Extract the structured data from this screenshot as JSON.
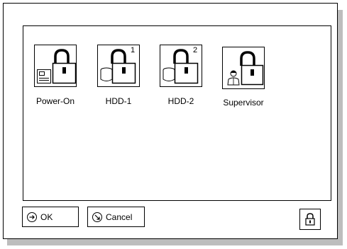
{
  "passwords": {
    "items": [
      {
        "id": "power-on",
        "label": "Power-On",
        "device": "system-board-icon",
        "badge": ""
      },
      {
        "id": "hdd-1",
        "label": "HDD-1",
        "device": "hard-disk-icon",
        "badge": "1"
      },
      {
        "id": "hdd-2",
        "label": "HDD-2",
        "device": "hard-disk-icon",
        "badge": "2"
      },
      {
        "id": "supervisor",
        "label": "Supervisor",
        "device": "supervisor-person-icon",
        "badge": ""
      }
    ]
  },
  "buttons": {
    "ok_label": "OK",
    "cancel_label": "Cancel",
    "ok_icon": "arrow-right-circle-icon",
    "cancel_icon": "arrow-diagonal-circle-icon",
    "lock_icon": "padlock-icon"
  }
}
